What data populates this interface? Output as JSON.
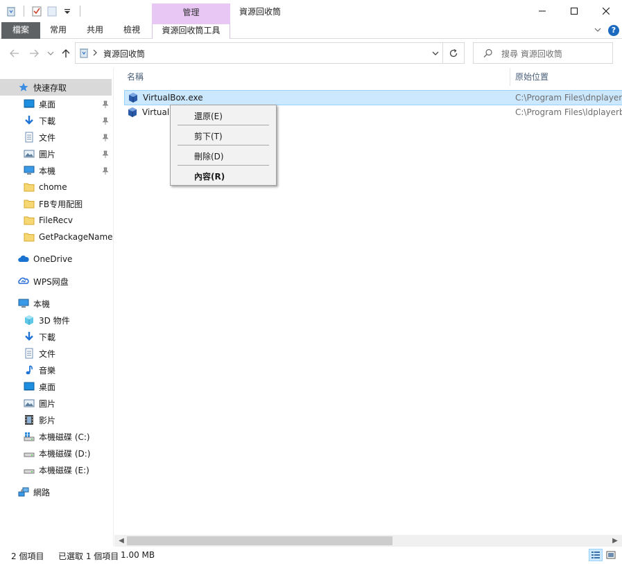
{
  "window": {
    "title": "資源回收筒",
    "context_tab_group": "管理"
  },
  "ribbon": {
    "tabs": [
      "檔案",
      "常用",
      "共用",
      "檢視",
      "資源回收筒工具"
    ]
  },
  "address": {
    "path": "資源回收筒",
    "search_placeholder": "搜尋 資源回收筒"
  },
  "nav": {
    "quick_access": "快速存取",
    "quick_items": [
      {
        "label": "桌面",
        "pinned": true
      },
      {
        "label": "下載",
        "pinned": true
      },
      {
        "label": "文件",
        "pinned": true
      },
      {
        "label": "圖片",
        "pinned": true
      },
      {
        "label": "本機",
        "pinned": true
      },
      {
        "label": "chome",
        "pinned": false
      },
      {
        "label": "FB专用配图",
        "pinned": false
      },
      {
        "label": "FileRecv",
        "pinned": false
      },
      {
        "label": "GetPackageName",
        "pinned": false
      }
    ],
    "onedrive": "OneDrive",
    "wps": "WPS网盘",
    "this_pc": "本機",
    "pc_items": [
      "3D 物件",
      "下載",
      "文件",
      "音樂",
      "桌面",
      "圖片",
      "影片",
      "本機磁碟 (C:)",
      "本機磁碟 (D:)",
      "本機磁碟 (E:)"
    ],
    "network": "網路"
  },
  "columns": {
    "name": "名稱",
    "location": "原始位置"
  },
  "files": [
    {
      "name": "VirtualBox.exe",
      "location": "C:\\Program Files\\dnplayere",
      "selected": true
    },
    {
      "name": "VirtualBox.exe",
      "location": "C:\\Program Files\\ldplayerbo",
      "selected": false
    }
  ],
  "context_menu": {
    "restore": "還原(E)",
    "cut": "剪下(T)",
    "delete": "刪除(D)",
    "properties": "內容(R)"
  },
  "status": {
    "count": "2 個項目",
    "selection": "已選取 1 個項目",
    "size": "1.00 MB"
  },
  "colors": {
    "selection_bg": "#cce8ff",
    "context_tab": "#e8c7f5",
    "file_tab": "#5f6265",
    "accent": "#1b6ac0"
  }
}
